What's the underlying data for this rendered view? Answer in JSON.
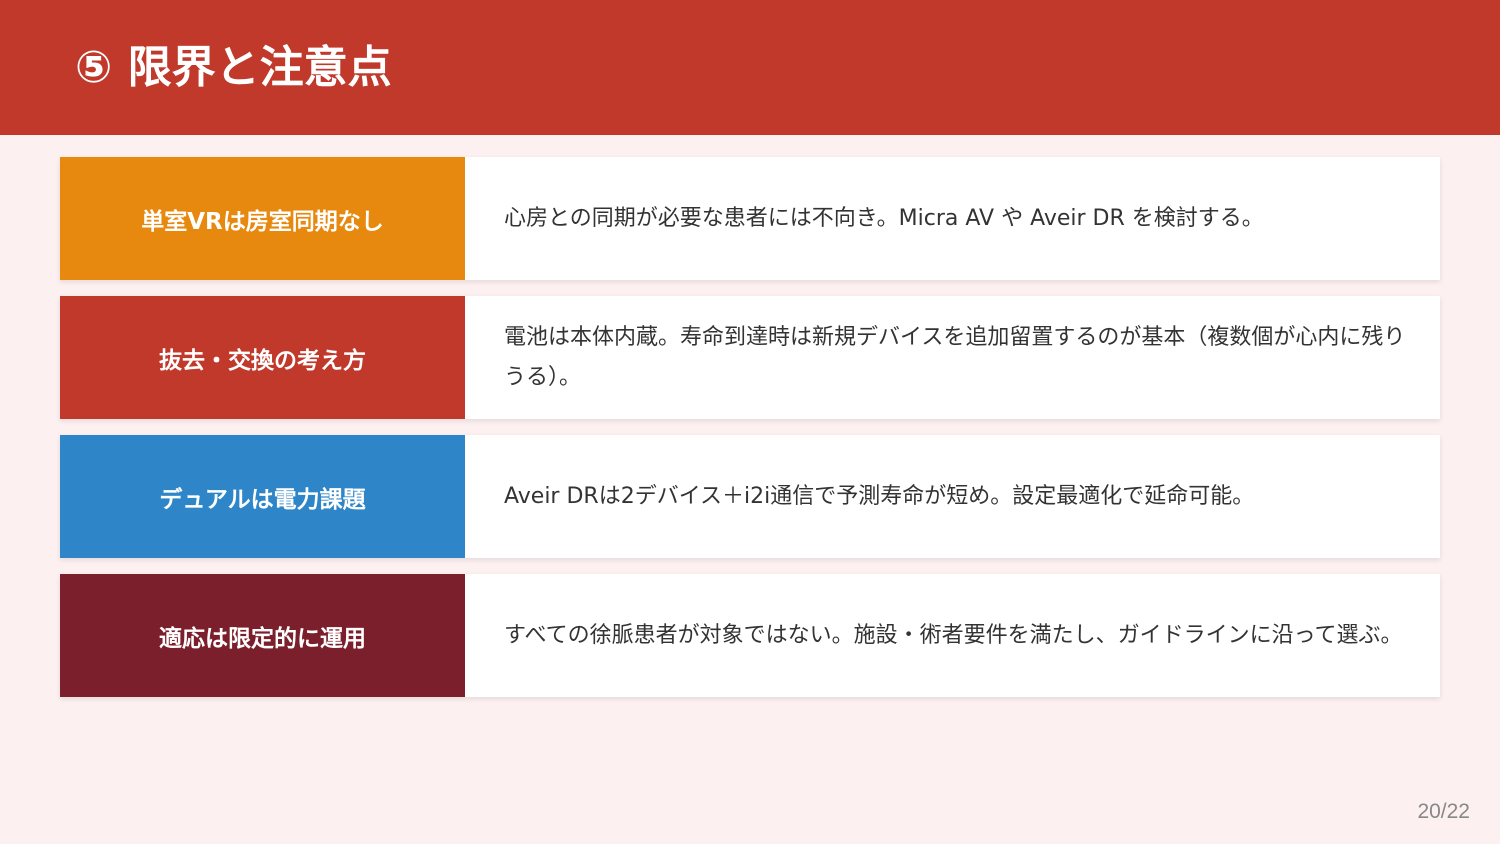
{
  "header": {
    "title": "⑤ 限界と注意点",
    "background": "#c0392b"
  },
  "rows": [
    {
      "label": "単室VRは房室同期なし",
      "text": "心房との同期が必要な患者には不向き。Micra AV や Aveir DR を検討する。",
      "color": "#e8890f"
    },
    {
      "label": "抜去・交換の考え方",
      "text": "電池は本体内蔵。寿命到達時は新規デバイスを追加留置するのが基本（複数個が心内に残りうる）。",
      "color": "#c0392b"
    },
    {
      "label": "デュアルは電力課題",
      "text": "Aveir DRは2デバイス＋i2i通信で予測寿命が短め。設定最適化で延命可能。",
      "color": "#2e86c8"
    },
    {
      "label": "適応は限定的に運用",
      "text": "すべての徐脈患者が対象ではない。施設・術者要件を満たし、ガイドラインに沿って選ぶ。",
      "color": "#7b1f2c"
    }
  ],
  "footer": {
    "page_number": "20/22"
  }
}
